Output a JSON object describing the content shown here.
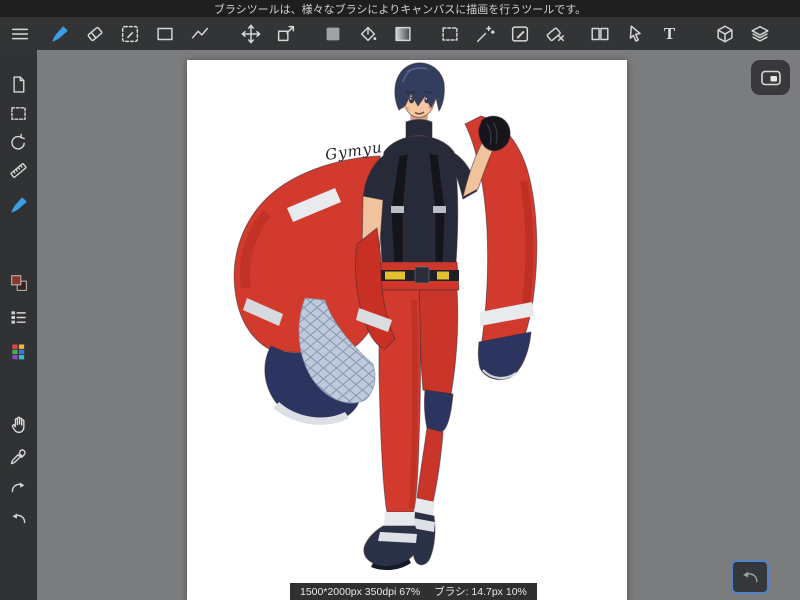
{
  "help_bar": {
    "text": "ブラシツールは、様々なブラシによりキャンバスに描画を行うツールです。"
  },
  "toolbar": {
    "text_tool_label": "T",
    "selected_tool": "brush",
    "tools": [
      "menu",
      "brush",
      "eraser",
      "select-pen",
      "rectangle",
      "polyline",
      "move",
      "transform",
      "color-swatch",
      "fill-bucket",
      "gradient",
      "marquee-select",
      "magic-wand",
      "pen-select",
      "deselect-eraser",
      "split-view",
      "object-cursor",
      "text",
      "material-cube",
      "layers"
    ]
  },
  "sidebar": {
    "tools": [
      "new-page",
      "select-area",
      "rotate-canvas",
      "ruler",
      "paint-brush",
      "color-swatches",
      "layer-list",
      "color-palette",
      "hand",
      "eyedropper",
      "redo",
      "undo"
    ]
  },
  "canvas": {
    "signature": "Gymyu"
  },
  "status_bar": {
    "canvas_info": "1500*2000px 350dpi 67%",
    "brush_info": "ブラシ: 14.7px 10%"
  },
  "colors": {
    "accent_blue": "#3aa0e8",
    "undo_button_border": "#4f82c8",
    "jacket_red": "#d23a2e",
    "navy": "#2b3560"
  }
}
